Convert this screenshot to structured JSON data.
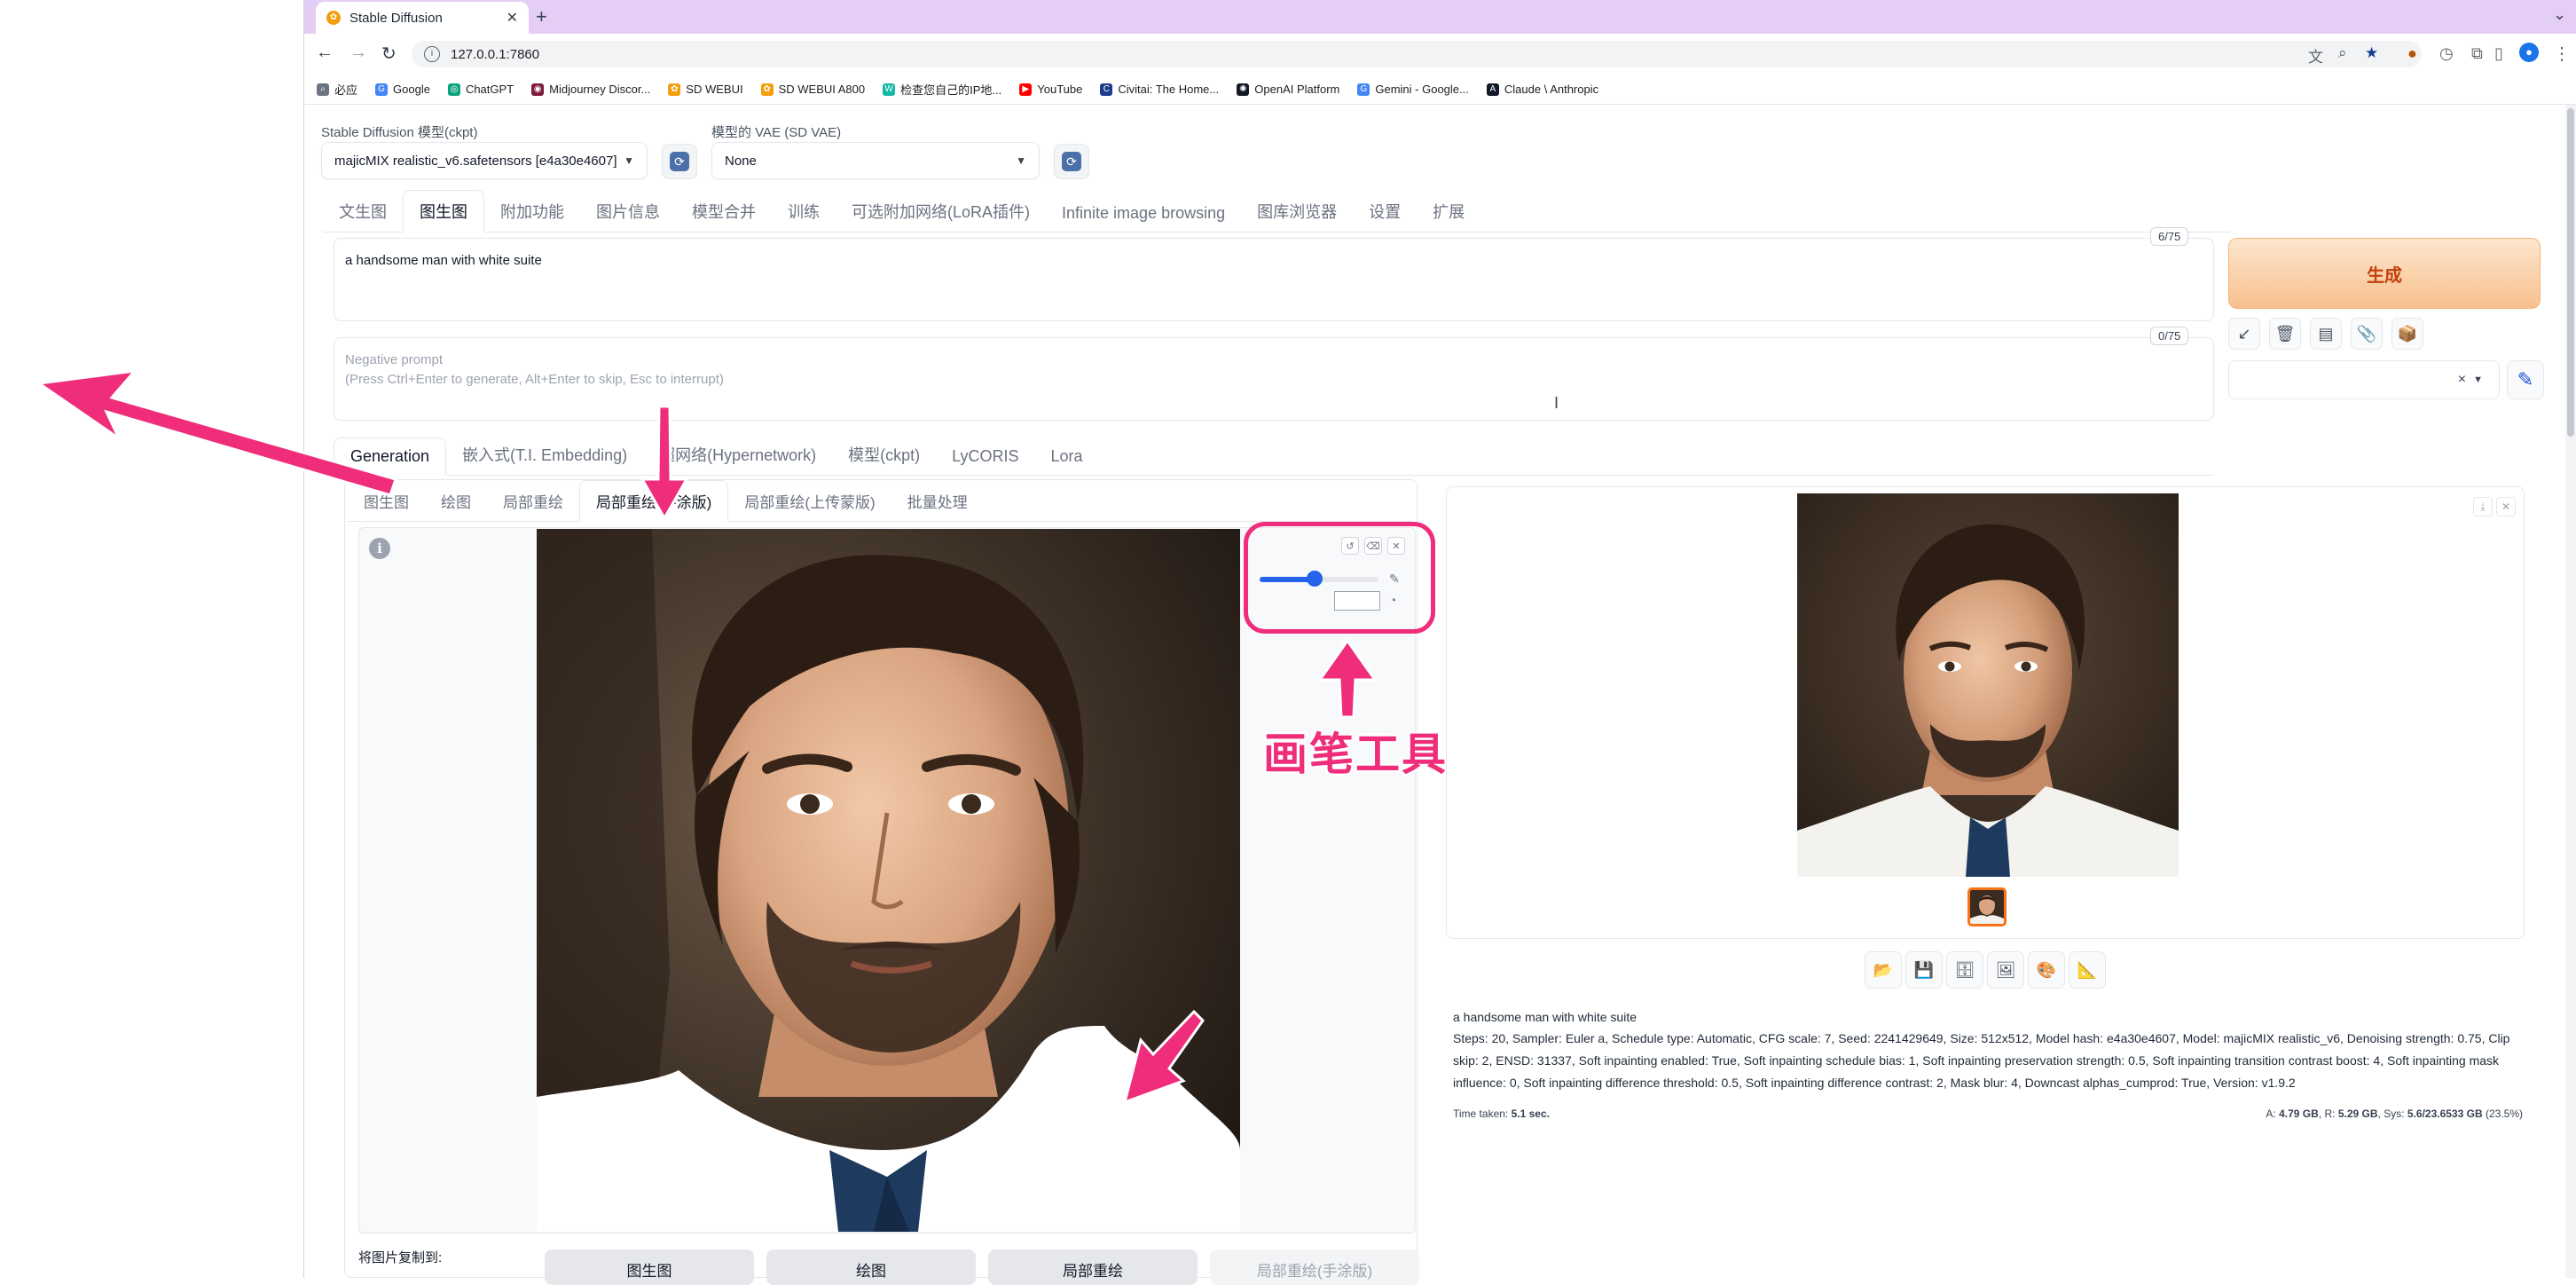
{
  "browser": {
    "tab_title": "Stable Diffusion",
    "url": "127.0.0.1:7860",
    "bookmarks": [
      "必应",
      "Google",
      "ChatGPT",
      "Midjourney Discor...",
      "SD WEBUI",
      "SD WEBUI A800",
      "检查您自己的IP地...",
      "YouTube",
      "Civitai: The Home...",
      "OpenAI Platform",
      "Gemini - Google...",
      "Claude \\ Anthropic"
    ]
  },
  "model": {
    "ckpt_label": "Stable Diffusion 模型(ckpt)",
    "ckpt_value": "majicMIX realistic_v6.safetensors [e4a30e4607]",
    "vae_label": "模型的 VAE (SD VAE)",
    "vae_value": "None"
  },
  "main_tabs": [
    "文生图",
    "图生图",
    "附加功能",
    "图片信息",
    "模型合并",
    "训练",
    "可选附加网络(LoRA插件)",
    "Infinite image browsing",
    "图库浏览器",
    "设置",
    "扩展"
  ],
  "main_tab_selected": "图生图",
  "prompt": {
    "positive": "a handsome man with white suite",
    "positive_count": "6/75",
    "negative_placeholder_1": "Negative prompt",
    "negative_placeholder_2": "(Press Ctrl+Enter to generate, Alt+Enter to skip, Esc to interrupt)",
    "negative_count": "0/75"
  },
  "generate_label": "生成",
  "style_clear": "×",
  "sub_tabs": [
    "Generation",
    "嵌入式(T.I. Embedding)",
    "超网络(Hypernetwork)",
    "模型(ckpt)",
    "LyCORIS",
    "Lora"
  ],
  "sub_tab_selected": "Generation",
  "img2img_tabs": [
    "图生图",
    "绘图",
    "局部重绘",
    "局部重绘(手涂版)",
    "局部重绘(上传蒙版)",
    "批量处理"
  ],
  "img2img_tab_selected": "局部重绘(手涂版)",
  "annotation_label": "画笔工具",
  "copy_to": {
    "label": "将图片复制到:",
    "buttons": [
      "图生图",
      "绘图",
      "局部重绘",
      "局部重绘(手涂版)"
    ]
  },
  "output": {
    "prompt": "a handsome man with white suite",
    "params": "Steps: 20, Sampler: Euler a, Schedule type: Automatic, CFG scale: 7, Seed: 2241429649, Size: 512x512, Model hash: e4a30e4607, Model: majicMIX realistic_v6, Denoising strength: 0.75, Clip skip: 2, ENSD: 31337, Soft inpainting enabled: True, Soft inpainting schedule bias: 1, Soft inpainting preservation strength: 0.5, Soft inpainting transition contrast boost: 4, Soft inpainting mask influence: 0, Soft inpainting difference threshold: 0.5, Soft inpainting difference contrast: 2, Mask blur: 4, Downcast alphas_cumprod: True, Version: v1.9.2",
    "time_label": "Time taken:",
    "time_value": "5.1 sec.",
    "vram_a_label": "A:",
    "vram_a": "4.79 GB",
    "vram_r_label": "R:",
    "vram_r": "5.29 GB",
    "vram_sys_label": "Sys:",
    "vram_sys": "5.6/23.6533 GB",
    "vram_pct": "(23.5%)"
  },
  "brush": {
    "size_fraction": 0.46
  },
  "colors": {
    "accent": "#ef2d7a",
    "generate": "#f7c08e",
    "brush": "#2563eb"
  }
}
